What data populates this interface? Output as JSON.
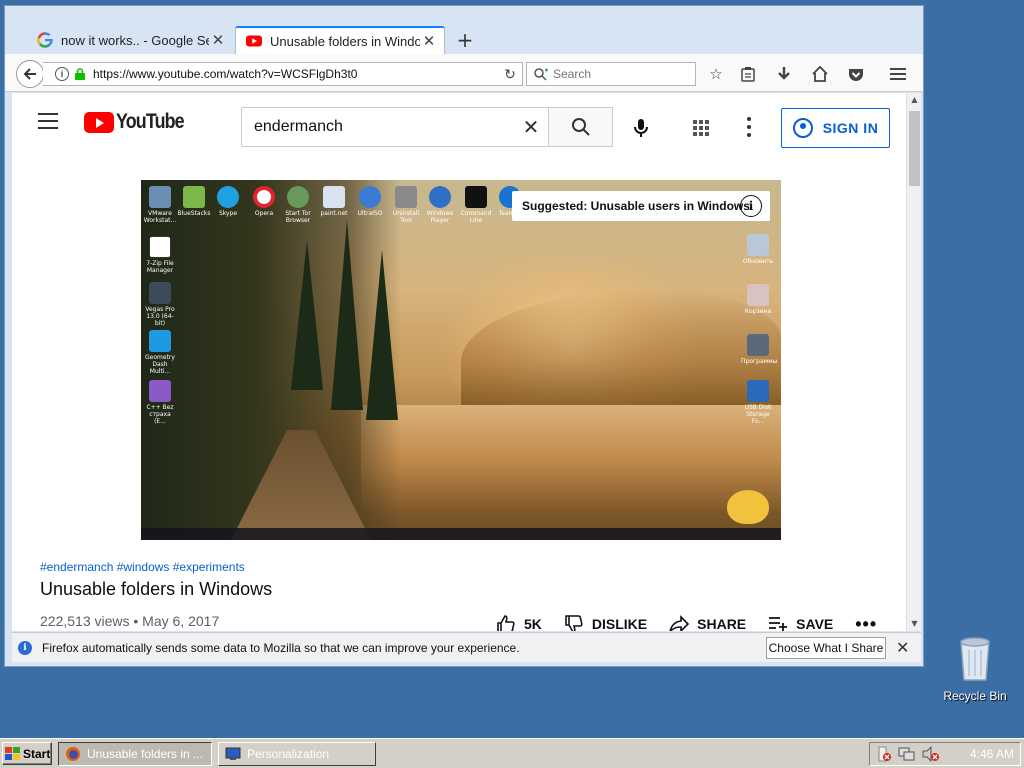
{
  "browser": {
    "tabs": [
      {
        "title": "now it works.. - Google Se...",
        "icon": "google-icon",
        "active": false
      },
      {
        "title": "Unusable folders in Windo...",
        "icon": "youtube-icon",
        "active": true
      }
    ],
    "url": "https://www.youtube.com/watch?v=WCSFlgDh3t0",
    "search_placeholder": "Search",
    "accent": "#0a84ff"
  },
  "youtube": {
    "logo_text": "YouTube",
    "search_query": "endermanch",
    "sign_in": "SIGN IN",
    "brand_color": "#ff0000",
    "link_color": "#065fd4"
  },
  "video": {
    "suggestion": "Suggested: Unusable users in Windows",
    "hashtags": "#endermanch #windows #experiments",
    "title": "Unusable folders in Windows",
    "meta": "222,513 views • May 6, 2017",
    "actions": {
      "like": "5K",
      "dislike": "DISLIKE",
      "share": "SHARE",
      "save": "SAVE"
    },
    "desktop_icons": [
      "VMware Workstat...",
      "BlueStacks",
      "Skype",
      "Opera",
      "Start Tor Browser",
      "paint.net",
      "UltraISO",
      "Uninstall Tool",
      "Windows Player",
      "Command Line",
      "Teamv..",
      "7-Zip File Manager",
      "Vegas Pro 13.0 (64-bit)",
      "Geometry Dash Multi...",
      "C++ Bez страха (E...",
      "Обновить",
      "Корзина",
      "Программы",
      "USB Disk Storage Fo..."
    ]
  },
  "notification": {
    "text": "Firefox automatically sends some data to Mozilla so that we can improve your experience.",
    "button": "Choose What I Share"
  },
  "desktop": {
    "recycle_bin": "Recycle Bin"
  },
  "taskbar": {
    "start": "Start",
    "items": [
      "Unusable folders in ...",
      "Personalization"
    ],
    "clock": "4:46 AM"
  }
}
